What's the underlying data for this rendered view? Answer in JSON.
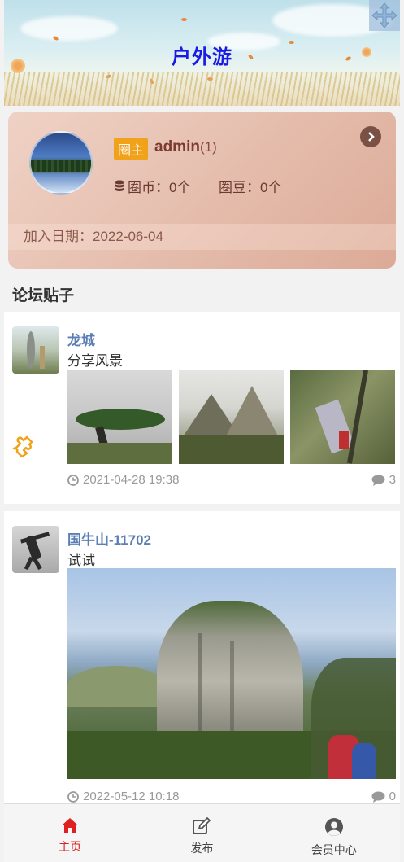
{
  "banner": {
    "title": "户外游"
  },
  "profile": {
    "badge": "圈主",
    "username": "admin",
    "level": "(1)",
    "coins": "圈币：0个",
    "beans": "圈豆：0个",
    "join_date": "加入日期：2022-06-04"
  },
  "forum": {
    "section_title": "论坛贴子"
  },
  "posts": [
    {
      "title": "龙城",
      "desc": "分享风景",
      "time": "2021-04-28 19:38",
      "comments": "3"
    },
    {
      "title": "国牛山-11702",
      "desc": "试试",
      "time": "2022-05-12 10:18",
      "comments": "0"
    }
  ],
  "tabs": [
    {
      "label": "主页",
      "icon": "home-icon",
      "active": true
    },
    {
      "label": "发布",
      "icon": "edit-icon",
      "active": false
    },
    {
      "label": "会员中心",
      "icon": "user-circle-icon",
      "active": false
    }
  ],
  "colors": {
    "accent": "#e02020",
    "badge": "#f0a21a",
    "link": "#5b7fb5",
    "title": "#1a1ae6"
  }
}
